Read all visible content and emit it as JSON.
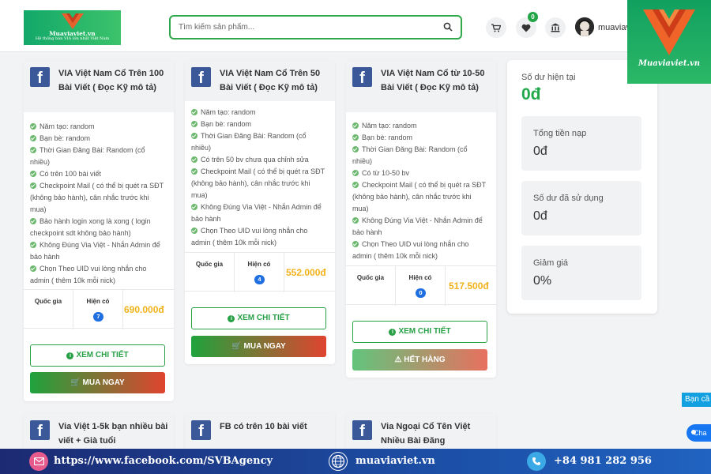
{
  "header": {
    "logo_text": "Muaviaviet.vn",
    "logo_tagline": "Hệ thống bán VIA lớn nhất Việt Nam",
    "search_placeholder": "Tìm kiếm sản phẩm...",
    "wishlist_count": "0",
    "username": "muaviav"
  },
  "brand_overlay": {
    "text": "Muaviaviet.vn"
  },
  "labels": {
    "country": "Quốc gia",
    "in_stock": "Hiện có",
    "detail": "XEM CHI TIẾT",
    "buy": "MUA NGAY",
    "sold_out": "HẾT HÀNG"
  },
  "products": [
    {
      "title": "VIA Việt Nam Cổ Trên 100 Bài Viết ( Đọc Kỹ mô tả)",
      "features": [
        "Năm tạo: random",
        "Bạn bè: random",
        "Thời Gian Đăng Bài: Random (cổ nhiều)",
        "Có trên 100 bài viết",
        "Checkpoint Mail ( có thể bị quét ra SĐT (không bảo hành), cân nhắc trước khi mua)",
        "Bảo hành login xong là xong ( login checkpoint sdt không bảo hành)",
        "Không Đúng Via Việt - Nhắn Admin để bảo hành",
        "Chọn Theo UID vui lòng nhắn cho admin ( thêm 10k mỗi nick)"
      ],
      "quantity": "7",
      "price": "690.000đ"
    },
    {
      "title": "VIA Việt Nam Cổ Trên 50 Bài Viết ( Đọc Kỹ mô tả)",
      "features": [
        "Năm tạo: random",
        "Bạn bè: random",
        "Thời Gian Đăng Bài: Random (cổ nhiều)",
        "Có trên 50 bv chưa qua chỉnh sửa",
        "Checkpoint Mail ( có thể bị quét ra SĐT (không bảo hành), cân nhắc trước khi mua)",
        "Không Đúng Via Việt - Nhắn Admin để bảo hành",
        "Chọn Theo UID vui lòng nhắn cho admin ( thêm 10k mỗi nick)"
      ],
      "quantity": "4",
      "price": "552.000đ"
    },
    {
      "title": "VIA Việt Nam Cổ từ 10-50 Bài Viết ( Đọc Kỹ mô tả)",
      "features": [
        "Năm tạo: random",
        "Bạn bè: random",
        "Thời Gian Đăng Bài: Random (cổ nhiều)",
        "Có từ 10-50 bv",
        "Checkpoint Mail ( có thể bị quét ra SĐT (không bảo hành), cân nhắc trước khi mua)",
        "Không Đúng Via Việt - Nhắn Admin để bảo hành",
        "Chọn Theo UID vui lòng nhắn cho admin ( thêm 10k mỗi nick)"
      ],
      "quantity": "0",
      "price": "517.500đ"
    },
    {
      "title": "Via Việt 1-5k bạn nhiều bài viết + Già tuổi"
    },
    {
      "title": "FB có trên 10 bài viết"
    },
    {
      "title": "Via Ngoại Cổ Tên Việt Nhiều Bài Đăng"
    }
  ],
  "balance": {
    "current_label": "Số dư hiện tại",
    "current_value": "0đ",
    "deposited_label": "Tổng tiền nạp",
    "deposited_value": "0đ",
    "used_label": "Số dư đã sử dụng",
    "used_value": "0đ",
    "discount_label": "Giảm giá",
    "discount_value": "0%"
  },
  "floating": {
    "support": "Bạn cầ",
    "chat": "Cha"
  },
  "footer": {
    "facebook": "https://www.facebook.com/SVBAgency",
    "website": "muaviaviet.vn",
    "phone": "+84 981 282 956"
  },
  "colors": {
    "brand_green": "#21a84b",
    "price": "#f2b21b",
    "facebook": "#3b5998"
  }
}
